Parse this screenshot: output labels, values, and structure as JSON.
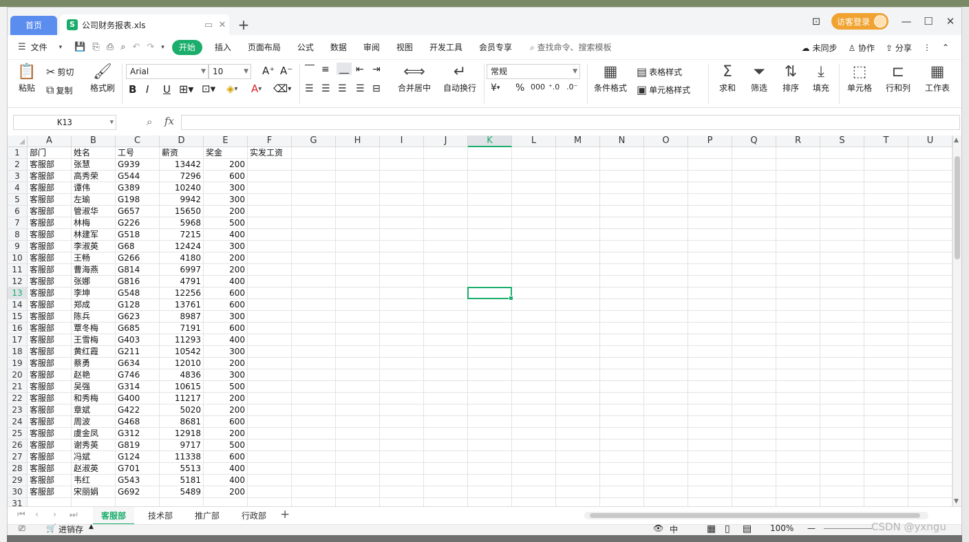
{
  "titlebar": {
    "home_tab": "首页",
    "file_tab": "公司财务报表.xls",
    "file_icon": "S",
    "login_label": "访客登录"
  },
  "menubar": {
    "file_label": "文件",
    "start_label": "开始",
    "items": [
      "插入",
      "页面布局",
      "公式",
      "数据",
      "审阅",
      "视图",
      "开发工具",
      "会员专享"
    ],
    "search_placeholder": "查找命令、搜索模板",
    "right_items": [
      "未同步",
      "协作",
      "分享"
    ]
  },
  "ribbon": {
    "paste": "粘贴",
    "cut": "剪切",
    "copy": "复制",
    "format_painter": "格式刷",
    "font_name": "Arial",
    "font_size": "10",
    "merge_center": "合并居中",
    "wrap_text": "自动换行",
    "number_format": "常规",
    "cond_format": "条件格式",
    "table_style": "表格样式",
    "cell_style": "单元格样式",
    "sum": "求和",
    "filter": "筛选",
    "sort": "排序",
    "fill": "填充",
    "cell": "单元格",
    "row_col": "行和列",
    "worksheet": "工作表"
  },
  "formula_bar": {
    "name_box": "K13",
    "fx_label": "fx",
    "formula": ""
  },
  "sheet": {
    "columns": [
      "A",
      "B",
      "C",
      "D",
      "E",
      "F",
      "G",
      "H",
      "I",
      "J",
      "K",
      "L",
      "M",
      "N",
      "O",
      "P",
      "Q",
      "R",
      "S",
      "T",
      "U"
    ],
    "selected_column": "K",
    "selected_row": "13",
    "header": [
      "部门",
      "姓名",
      "工号",
      "薪资",
      "奖金",
      "实发工资"
    ],
    "rows": [
      [
        "客服部",
        "张慧",
        "G939",
        "13442",
        "200"
      ],
      [
        "客服部",
        "高秀荣",
        "G544",
        "7296",
        "600"
      ],
      [
        "客服部",
        "谭伟",
        "G389",
        "10240",
        "300"
      ],
      [
        "客服部",
        "左瑜",
        "G198",
        "9942",
        "300"
      ],
      [
        "客服部",
        "管淑华",
        "G657",
        "15650",
        "200"
      ],
      [
        "客服部",
        "林梅",
        "G226",
        "5968",
        "500"
      ],
      [
        "客服部",
        "林建军",
        "G518",
        "7215",
        "400"
      ],
      [
        "客服部",
        "李淑英",
        "G68",
        "12424",
        "300"
      ],
      [
        "客服部",
        "王畅",
        "G266",
        "4180",
        "200"
      ],
      [
        "客服部",
        "曹海燕",
        "G814",
        "6997",
        "200"
      ],
      [
        "客服部",
        "张娜",
        "G816",
        "4791",
        "400"
      ],
      [
        "客服部",
        "李坤",
        "G548",
        "12256",
        "600"
      ],
      [
        "客服部",
        "郑成",
        "G128",
        "13761",
        "600"
      ],
      [
        "客服部",
        "陈兵",
        "G623",
        "8987",
        "300"
      ],
      [
        "客服部",
        "覃冬梅",
        "G685",
        "7191",
        "600"
      ],
      [
        "客服部",
        "王雪梅",
        "G403",
        "11293",
        "400"
      ],
      [
        "客服部",
        "黄红霞",
        "G211",
        "10542",
        "300"
      ],
      [
        "客服部",
        "蔡勇",
        "G634",
        "12010",
        "200"
      ],
      [
        "客服部",
        "赵艳",
        "G746",
        "4836",
        "300"
      ],
      [
        "客服部",
        "吴强",
        "G314",
        "10615",
        "500"
      ],
      [
        "客服部",
        "和秀梅",
        "G400",
        "11217",
        "200"
      ],
      [
        "客服部",
        "章斌",
        "G422",
        "5020",
        "200"
      ],
      [
        "客服部",
        "周波",
        "G468",
        "8681",
        "600"
      ],
      [
        "客服部",
        "虞金凤",
        "G312",
        "12918",
        "200"
      ],
      [
        "客服部",
        "谢秀英",
        "G819",
        "9717",
        "500"
      ],
      [
        "客服部",
        "冯斌",
        "G124",
        "11338",
        "600"
      ],
      [
        "客服部",
        "赵淑英",
        "G701",
        "5513",
        "400"
      ],
      [
        "客服部",
        "韦红",
        "G543",
        "5181",
        "400"
      ],
      [
        "客服部",
        "宋丽娟",
        "G692",
        "5489",
        "200"
      ]
    ]
  },
  "sheet_tabs": [
    "客服部",
    "技术部",
    "推广部",
    "行政部"
  ],
  "active_sheet": "客服部",
  "statusbar": {
    "macro_label": "进销存",
    "input_mode": "中",
    "zoom": "100%"
  },
  "watermark": "CSDN @yxngu",
  "colors": {
    "accent": "#1aad6b",
    "home_tab": "#5b8def",
    "login": "#f0a330"
  }
}
